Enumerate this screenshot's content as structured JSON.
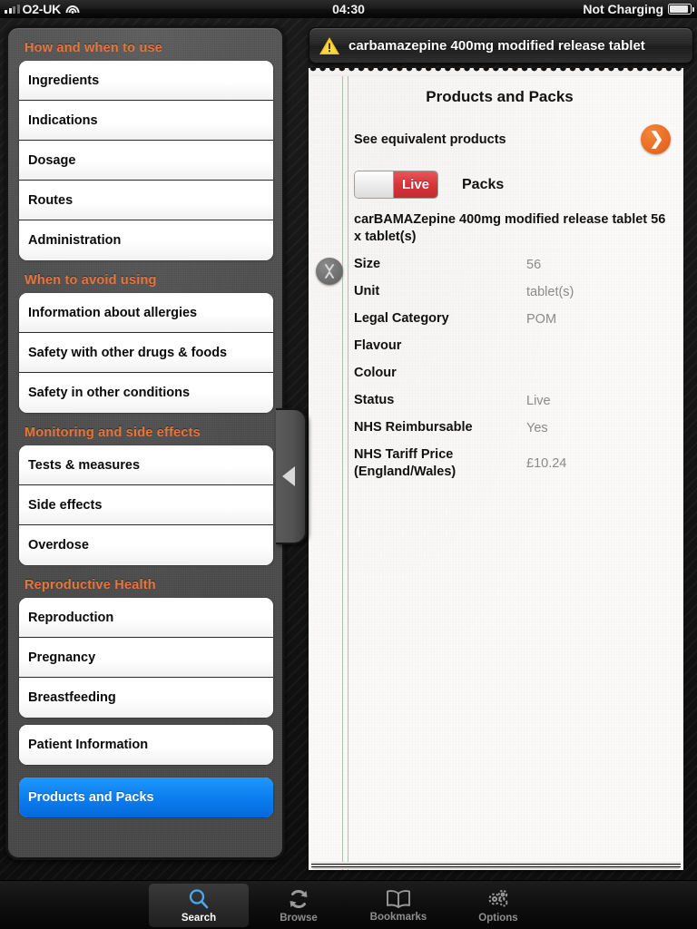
{
  "statusbar": {
    "carrier": "O2-UK",
    "time": "04:30",
    "battery_state": "Not Charging",
    "signal_icon": "signal-bars-icon",
    "wifi_icon": "wifi-icon",
    "battery_icon": "battery-icon"
  },
  "sidebar": {
    "sections": [
      {
        "title": "How and  when to use",
        "items": [
          "Ingredients",
          "Indications",
          "Dosage",
          "Routes",
          "Administration"
        ]
      },
      {
        "title": "When to avoid using",
        "items": [
          "Information about allergies",
          "Safety with other drugs & foods",
          "Safety in other conditions"
        ]
      },
      {
        "title": "Monitoring and side effects",
        "items": [
          "Tests & measures",
          "Side effects",
          "Overdose"
        ]
      },
      {
        "title": "Reproductive Health",
        "items": [
          "Reproduction",
          "Pregnancy",
          "Breastfeeding"
        ]
      }
    ],
    "patient_information": "Patient Information",
    "selected_item": "Products and Packs",
    "collapse_handle_icon": "triangle-left-icon",
    "accent_color": "#e8753a",
    "selected_color": "#0a7ff0"
  },
  "detail": {
    "titlebar": {
      "warning_icon": "warning-triangle-icon",
      "title": "carbamazepine  400mg modified release tablet"
    },
    "page_title": "Products and Packs",
    "equivalent_products": {
      "label": "See equivalent products",
      "arrow_icon": "chevron-right-icon",
      "arrow_color": "#e8671f"
    },
    "status_switch": {
      "label": "Live",
      "state": "on",
      "track_color": "#d5353b"
    },
    "packs_heading": "Packs",
    "expand_toggle_icon": "expand-collapse-icon",
    "pack_name": "carBAMAZepine  400mg modified release tablet 56 x tablet(s)",
    "fields": [
      {
        "label": "Size",
        "value": "56"
      },
      {
        "label": "Unit",
        "value": "tablet(s)"
      },
      {
        "label": "Legal Category",
        "value": "POM"
      },
      {
        "label": "Flavour",
        "value": ""
      },
      {
        "label": "Colour",
        "value": ""
      },
      {
        "label": "Status",
        "value": "Live"
      },
      {
        "label": "NHS Reimbursable",
        "value": "Yes"
      },
      {
        "label": "NHS Tariff Price (England/Wales)",
        "value": "£10.24"
      }
    ]
  },
  "tabbar": {
    "tabs": [
      {
        "label": "Search",
        "icon": "search-icon",
        "active": true
      },
      {
        "label": "Browse",
        "icon": "refresh-icon",
        "active": false
      },
      {
        "label": "Bookmarks",
        "icon": "book-icon",
        "active": false
      },
      {
        "label": "Options",
        "icon": "gears-icon",
        "active": false
      }
    ]
  }
}
